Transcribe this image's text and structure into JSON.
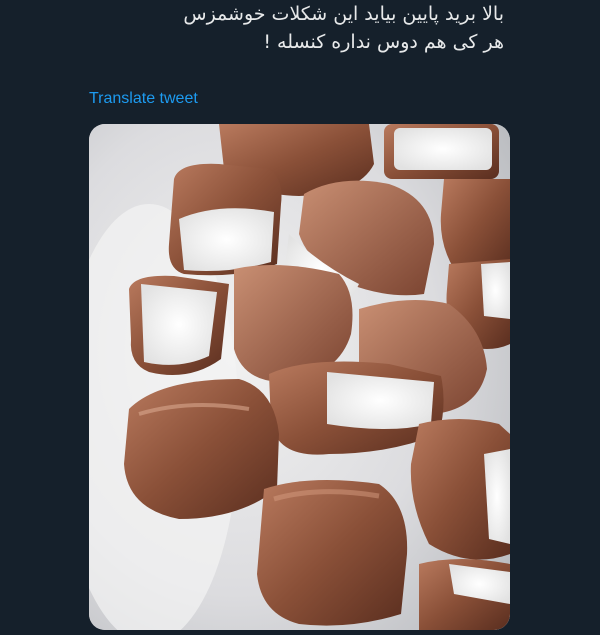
{
  "tweet": {
    "text_lines": [
      "بالا برید پایین بیاید این شکلات خوشمزس",
      "هر کی هم دوس نداره کنسله !"
    ],
    "translate_label": "Translate tweet"
  },
  "colors": {
    "background": "#15202b",
    "text": "#e7e9ea",
    "link": "#1d9bf0"
  }
}
